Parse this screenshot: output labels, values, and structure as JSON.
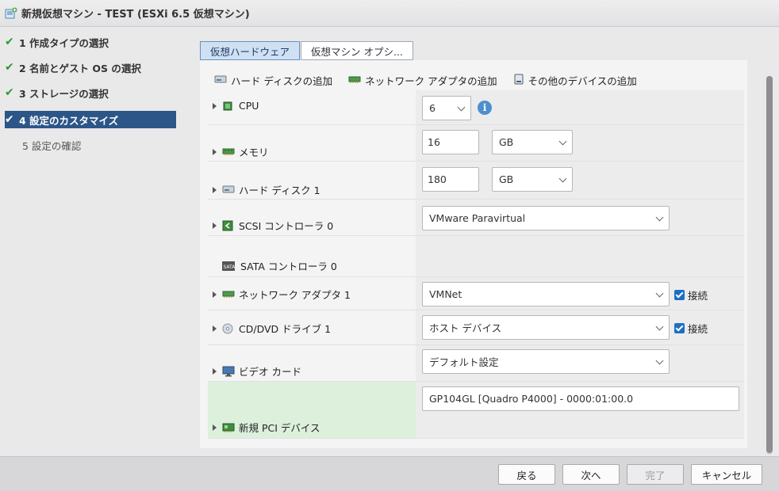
{
  "window": {
    "title": "新規仮想マシン - TEST (ESXi 6.5 仮想マシン)"
  },
  "steps": [
    {
      "label": "1 作成タイプの選択",
      "state": "done"
    },
    {
      "label": "2 名前とゲスト OS の選択",
      "state": "done"
    },
    {
      "label": "3 ストレージの選択",
      "state": "done"
    },
    {
      "label": "4 設定のカスタマイズ",
      "state": "active"
    },
    {
      "label": "5 設定の確認",
      "state": "pending"
    }
  ],
  "tabs": [
    {
      "label": "仮想ハードウェア",
      "active": true
    },
    {
      "label": "仮想マシン オプシ...",
      "active": false
    }
  ],
  "toolbar": {
    "add_hard_disk": "ハード ディスクの追加",
    "add_network_adapter": "ネットワーク アダプタの追加",
    "add_other_device": "その他のデバイスの追加"
  },
  "devices": {
    "cpu": {
      "label": "CPU",
      "value": "6"
    },
    "memory": {
      "label": "メモリ",
      "value": "16",
      "unit": "GB"
    },
    "hard_disk": {
      "label": "ハード ディスク 1",
      "value": "180",
      "unit": "GB"
    },
    "scsi": {
      "label": "SCSI コントローラ 0",
      "value": "VMware Paravirtual"
    },
    "sata": {
      "label": "SATA コントローラ 0"
    },
    "network": {
      "label": "ネットワーク アダプタ 1",
      "value": "VMNet",
      "connect_label": "接続",
      "connected": true
    },
    "cddvd": {
      "label": "CD/DVD ドライブ 1",
      "value": "ホスト デバイス",
      "connect_label": "接続",
      "connected": true
    },
    "video": {
      "label": "ビデオ カード",
      "value": "デフォルト設定"
    },
    "pci": {
      "label": "新規 PCI デバイス",
      "value": "GP104GL [Quadro P4000] - 0000:01:00.0"
    }
  },
  "footer": {
    "back": "戻る",
    "next": "次へ",
    "finish": "完了",
    "cancel": "キャンセル"
  },
  "colors": {
    "accent": "#2c5687",
    "check": "#2f9a2f",
    "highlight_row": "#dcf0dc",
    "checkbox": "#1c6fc7"
  }
}
